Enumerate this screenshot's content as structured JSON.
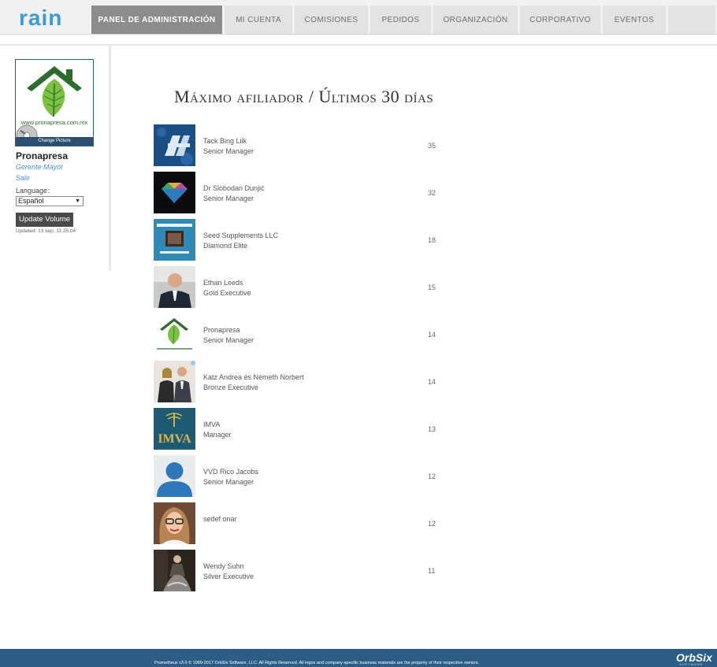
{
  "brand": {
    "logo_text": "rain",
    "accent": "#3d9ad6"
  },
  "nav": {
    "tabs": [
      {
        "label": "PANEL DE ADMINISTRACIÓN",
        "active": true
      },
      {
        "label": "MI CUENTA",
        "active": false
      },
      {
        "label": "COMISIONES",
        "active": false
      },
      {
        "label": "PEDIDOS",
        "active": false
      },
      {
        "label": "ORGANIZACIÓN",
        "active": false
      },
      {
        "label": "CORPORATIVO",
        "active": false
      },
      {
        "label": "EVENTOS",
        "active": false
      },
      {
        "label": "",
        "active": false
      }
    ]
  },
  "sidebar": {
    "profile_site": "www.pronapresa.com.mx",
    "change_picture": "Change Picture",
    "name": "Pronapresa",
    "rank": "Gerente Mayor",
    "logout": "Salir",
    "language_label": "Language:",
    "language_value": "Español",
    "update_button": "Update Volume",
    "updated_text": "Updated: 13 sep, 11:25:04"
  },
  "main": {
    "title": "Máximo afiliador / Últimos 30 días",
    "rows": [
      {
        "name": "Tack Bing Liik",
        "rank": "Senior Manager",
        "count": "35",
        "avatar": "blue-logo-icon"
      },
      {
        "name": "Dr Slobodan Dunjić",
        "rank": "Senior Manager",
        "count": "32",
        "avatar": "gem-icon"
      },
      {
        "name": "Seed Supplements LLC",
        "rank": "Diamond Elite",
        "count": "18",
        "avatar": "book-cover-icon"
      },
      {
        "name": "Ethan Leeds",
        "rank": "Gold Executive",
        "count": "15",
        "avatar": "person-photo"
      },
      {
        "name": "Pronapresa",
        "rank": "Senior Manager",
        "count": "14",
        "avatar": "house-leaf-logo"
      },
      {
        "name": "Katz Andrea és Németh Norbert",
        "rank": "Bronze Executive",
        "count": "14",
        "avatar": "couple-photo"
      },
      {
        "name": "IMVA",
        "rank": "Manager",
        "count": "13",
        "avatar": "imva-logo"
      },
      {
        "name": "VVD Rico Jacobs",
        "rank": "Senior Manager",
        "count": "12",
        "avatar": "default-user-icon"
      },
      {
        "name": "sedef onar",
        "rank": "",
        "count": "12",
        "avatar": "woman-photo"
      },
      {
        "name": "Wendy Suhn",
        "rank": "Silver Executive",
        "count": "11",
        "avatar": "dancer-photo"
      }
    ]
  },
  "footer": {
    "text": "Prometheus v3.0 © 1999-2017 OrbSix Software, LLC. All Rights Reserved. All logos and company-specific business materials are the property of their respective owners.",
    "brand": "OrbSix",
    "brand_sub": "SOFTWARE"
  }
}
